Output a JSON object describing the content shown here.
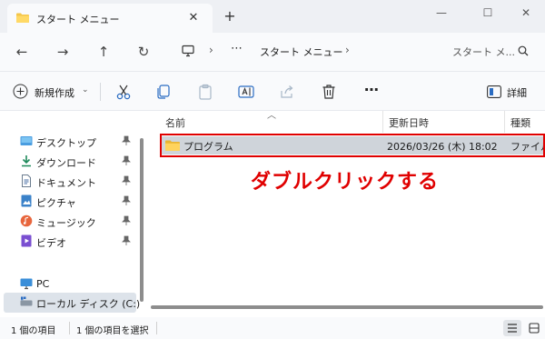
{
  "window": {
    "tab_title": "スタート メニュー",
    "close_tab_glyph": "✕",
    "new_tab_glyph": "+",
    "minimize_glyph": "—",
    "maximize_glyph": "☐",
    "close_glyph": "✕"
  },
  "navigation": {
    "back_glyph": "←",
    "forward_glyph": "→",
    "up_glyph": "↑",
    "refresh_glyph": "↻",
    "breadcrumb_separator": "›",
    "overflow_glyph": "⋯",
    "current_folder": "スタート メニュー",
    "search_placeholder": "スタート メ..."
  },
  "toolbar": {
    "new_label": "新規作成",
    "new_chevron": "⌄",
    "more_glyph": "⋯",
    "details_label": "詳細",
    "icons": [
      "cut-icon",
      "copy-icon",
      "paste-icon",
      "rename-icon",
      "share-icon",
      "delete-icon"
    ]
  },
  "sidebar": {
    "quick_access": [
      {
        "label": "デスクトップ",
        "icon": "desktop-icon",
        "pinned": true
      },
      {
        "label": "ダウンロード",
        "icon": "download-icon",
        "pinned": true
      },
      {
        "label": "ドキュメント",
        "icon": "document-icon",
        "pinned": true
      },
      {
        "label": "ピクチャ",
        "icon": "pictures-icon",
        "pinned": true
      },
      {
        "label": "ミュージック",
        "icon": "music-icon",
        "pinned": true
      },
      {
        "label": "ビデオ",
        "icon": "video-icon",
        "pinned": true
      }
    ],
    "this_pc": {
      "label": "PC",
      "icon": "pc-icon"
    },
    "local_disk": {
      "label": "ローカル ディスク (C:)",
      "icon": "drive-icon"
    }
  },
  "file_list": {
    "columns": [
      "名前",
      "更新日時",
      "種類"
    ],
    "rows": [
      {
        "name": "プログラム",
        "modified": "2026/03/26 (木) 18:02",
        "type": "ファイル"
      }
    ]
  },
  "annotation": {
    "text": "ダブルクリックする",
    "color": "#e00000"
  },
  "status": {
    "item_count": "1 個の項目",
    "selected_count": "1 個の項目を選択"
  },
  "colors": {
    "accent_folder": "#f4c64a",
    "selection": "#cfd4da",
    "highlight": "#e00000"
  }
}
